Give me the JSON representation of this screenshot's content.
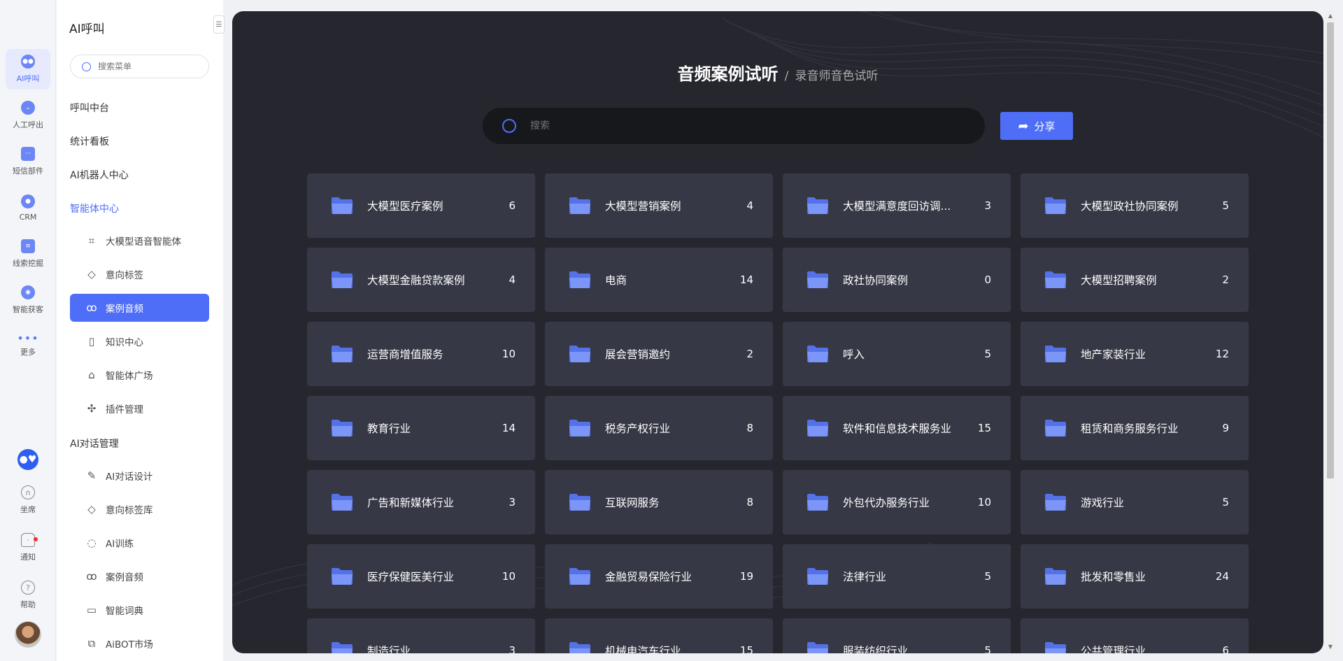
{
  "rail": {
    "items": [
      {
        "label": "AI呼叫",
        "icon": "ai-call-icon"
      },
      {
        "label": "人工呼出",
        "icon": "manual-call-icon"
      },
      {
        "label": "短信部件",
        "icon": "sms-icon"
      },
      {
        "label": "CRM",
        "icon": "crm-icon"
      },
      {
        "label": "线索挖掘",
        "icon": "lead-mining-icon"
      },
      {
        "label": "智能获客",
        "icon": "smart-acquire-icon"
      },
      {
        "label": "更多",
        "icon": "more-icon"
      }
    ],
    "bottom": [
      {
        "label": "坐席",
        "icon": "headset-icon"
      },
      {
        "label": "通知",
        "icon": "bell-icon"
      },
      {
        "label": "帮助",
        "icon": "help-icon"
      }
    ]
  },
  "sidebar": {
    "title": "AI呼叫",
    "search_placeholder": "搜索菜单",
    "groups": {
      "call_center": "呼叫中台",
      "stats": "统计看板",
      "robot_center": "AI机器人中心",
      "agent_center": "智能体中心",
      "dialog_mgmt": "AI对话管理"
    },
    "agent_items": [
      "大模型语音智能体",
      "意向标签",
      "案例音频",
      "知识中心",
      "智能体广场",
      "插件管理"
    ],
    "dialog_items": [
      "AI对话设计",
      "意向标签库",
      "AI训练",
      "案例音频",
      "智能词典",
      "AiBOT市场"
    ]
  },
  "main": {
    "title": "音频案例试听",
    "separator": "/",
    "subtitle": "录音师音色试听",
    "search_placeholder": "搜索",
    "share_label": "分享",
    "cards": [
      {
        "name": "大模型医疗案例",
        "count": "6"
      },
      {
        "name": "大模型营销案例",
        "count": "4"
      },
      {
        "name": "大模型满意度回访调...",
        "count": "3"
      },
      {
        "name": "大模型政社协同案例",
        "count": "5"
      },
      {
        "name": "大模型金融贷款案例",
        "count": "4"
      },
      {
        "name": "电商",
        "count": "14"
      },
      {
        "name": "政社协同案例",
        "count": "0"
      },
      {
        "name": "大模型招聘案例",
        "count": "2"
      },
      {
        "name": "运营商增值服务",
        "count": "10"
      },
      {
        "name": "展会营销邀约",
        "count": "2"
      },
      {
        "name": "呼入",
        "count": "5"
      },
      {
        "name": "地产家装行业",
        "count": "12"
      },
      {
        "name": "教育行业",
        "count": "14"
      },
      {
        "name": "税务产权行业",
        "count": "8"
      },
      {
        "name": "软件和信息技术服务业",
        "count": "15"
      },
      {
        "name": "租赁和商务服务行业",
        "count": "9"
      },
      {
        "name": "广告和新媒体行业",
        "count": "3"
      },
      {
        "name": "互联网服务",
        "count": "8"
      },
      {
        "name": "外包代办服务行业",
        "count": "10"
      },
      {
        "name": "游戏行业",
        "count": "5"
      },
      {
        "name": "医疗保健医美行业",
        "count": "10"
      },
      {
        "name": "金融贸易保险行业",
        "count": "19"
      },
      {
        "name": "法律行业",
        "count": "5"
      },
      {
        "name": "批发和零售业",
        "count": "24"
      },
      {
        "name": "制造行业",
        "count": "3"
      },
      {
        "name": "机械电汽车行业",
        "count": "15"
      },
      {
        "name": "服装纺织行业",
        "count": "5"
      },
      {
        "name": "公共管理行业",
        "count": "6"
      }
    ]
  },
  "colors": {
    "accent": "#4f6ef7",
    "panel_bg": "#26272e",
    "card_bg": "#363845",
    "folder": "#6f8cf7"
  }
}
